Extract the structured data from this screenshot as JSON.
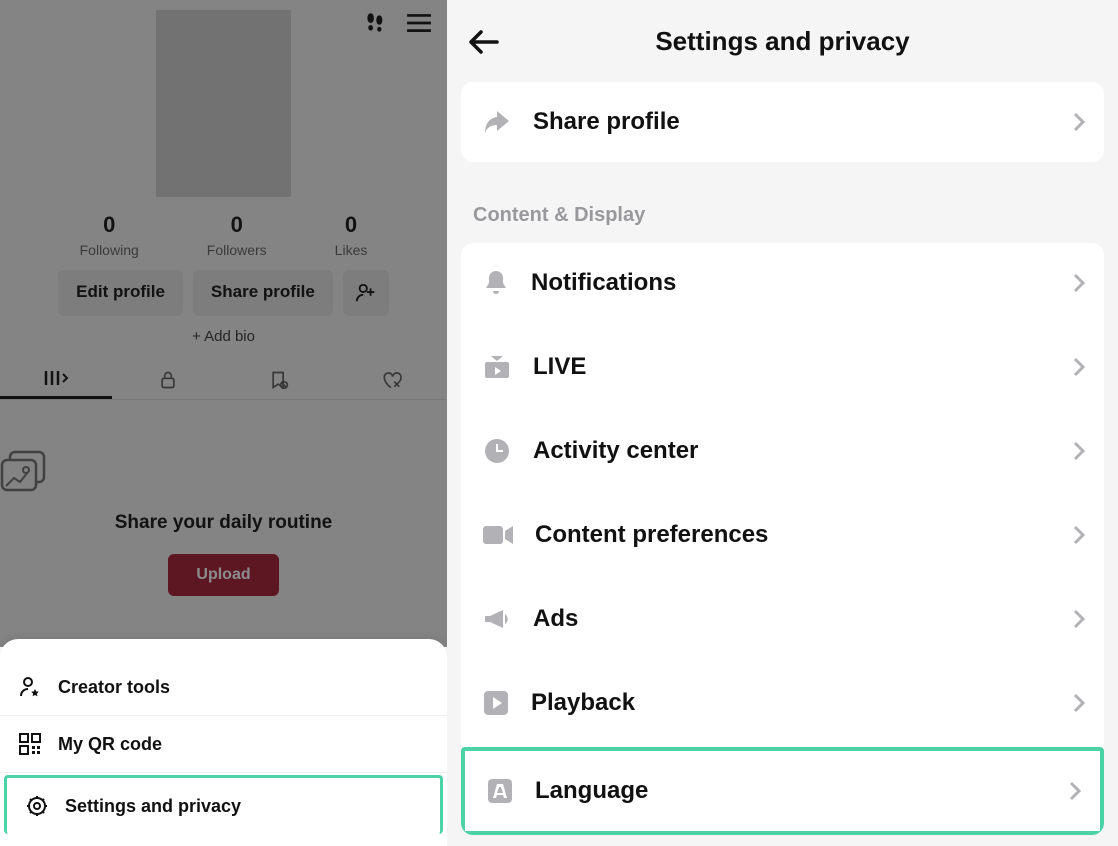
{
  "left": {
    "stats": {
      "following_count": "0",
      "following_label": "Following",
      "followers_count": "0",
      "followers_label": "Followers",
      "likes_count": "0",
      "likes_label": "Likes"
    },
    "buttons": {
      "edit": "Edit profile",
      "share": "Share profile"
    },
    "add_bio": "+ Add bio",
    "empty_title": "Share your daily routine",
    "upload": "Upload",
    "sheet": {
      "creator_tools": "Creator tools",
      "qr": "My QR code",
      "settings": "Settings and privacy"
    }
  },
  "right": {
    "title": "Settings and privacy",
    "share_profile": "Share profile",
    "section": "Content & Display",
    "items": {
      "notifications": "Notifications",
      "live": "LIVE",
      "activity": "Activity center",
      "content_pref": "Content preferences",
      "ads": "Ads",
      "playback": "Playback",
      "language": "Language"
    }
  }
}
